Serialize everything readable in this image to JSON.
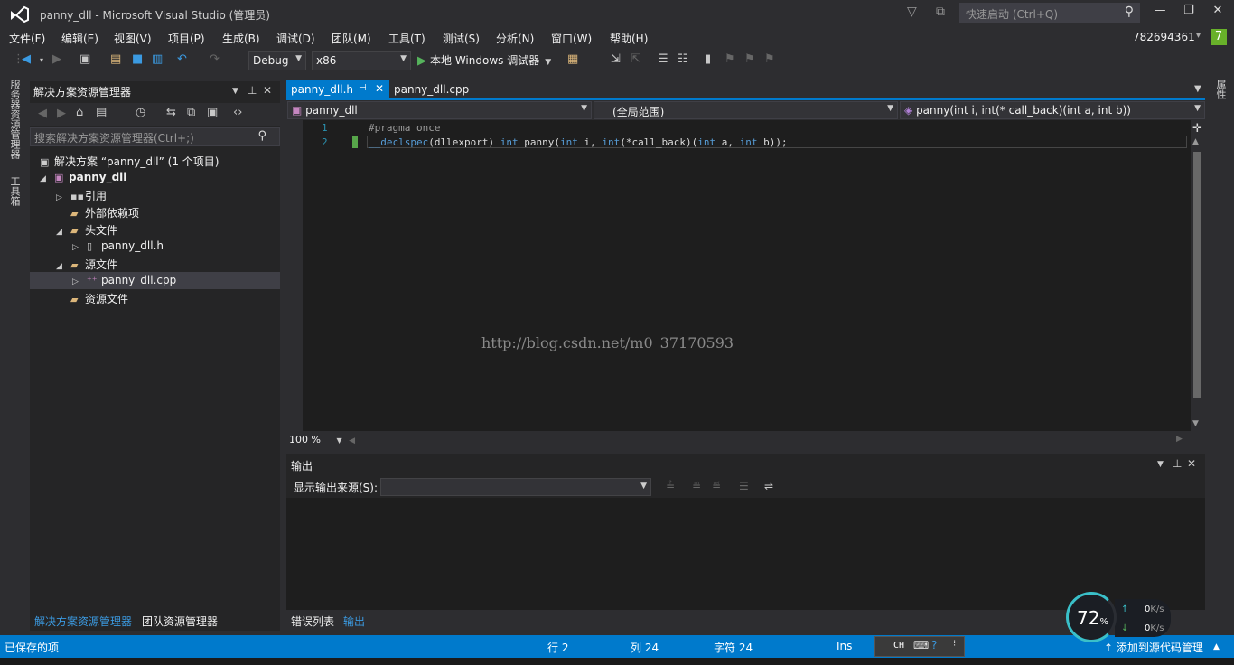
{
  "window": {
    "title": "panny_dll - Microsoft Visual Studio (管理员)",
    "quick_launch_placeholder": "快速启动 (Ctrl+Q)",
    "user_name": "782694361",
    "notification_count": "7"
  },
  "menu": [
    "文件(F)",
    "编辑(E)",
    "视图(V)",
    "项目(P)",
    "生成(B)",
    "调试(D)",
    "团队(M)",
    "工具(T)",
    "测试(S)",
    "分析(N)",
    "窗口(W)",
    "帮助(H)"
  ],
  "toolbar": {
    "config": "Debug",
    "platform": "x86",
    "run_label": "本地 Windows 调试器"
  },
  "left_strip": {
    "tab1": "服务器资源管理器",
    "tab2": "工具箱"
  },
  "right_strip": {
    "tab1": "属性"
  },
  "solution_explorer": {
    "title": "解决方案资源管理器",
    "search_placeholder": "搜索解决方案资源管理器(Ctrl+;)",
    "tree": {
      "solution": "解决方案 “panny_dll” (1 个项目)",
      "project": "panny_dll",
      "references": "引用",
      "external": "外部依赖项",
      "headers": "头文件",
      "header_file": "panny_dll.h",
      "sources": "源文件",
      "source_file": "panny_dll.cpp",
      "resources": "资源文件"
    },
    "bottom_tabs": [
      "解决方案资源管理器",
      "团队资源管理器"
    ]
  },
  "editor": {
    "tabs": [
      "panny_dll.h",
      "panny_dll.cpp"
    ],
    "nav": {
      "project": "panny_dll",
      "scope": "(全局范围)",
      "member": "panny(int i, int(* call_back)(int a, int b))"
    },
    "line_numbers": [
      "1",
      "2"
    ],
    "code": {
      "line1": "#pragma once",
      "line2_parts": [
        "__declspec",
        "(dllexport) ",
        "int",
        " panny(",
        "int",
        " i, ",
        "int",
        "(*call_back)(",
        "int",
        " a, ",
        "int",
        " b));"
      ]
    },
    "watermark": "http://blog.csdn.net/m0_37170593",
    "zoom": "100 %"
  },
  "output": {
    "title": "输出",
    "source_label": "显示输出来源(S):",
    "source_value": "",
    "bottom_tabs": [
      "错误列表",
      "输出"
    ]
  },
  "status": {
    "message": "已保存的项",
    "line": "行 2",
    "col": "列 24",
    "char": "字符 24",
    "mode": "Ins",
    "ime": "CH",
    "publish": "添加到源代码管理"
  },
  "net_monitor": {
    "percent": "72",
    "unit": "%",
    "up": "0",
    "down": "0",
    "rate_unit": "K/s"
  },
  "colors": {
    "accent": "#007acc",
    "background": "#2d2d30",
    "editor_bg": "#1e1e1e",
    "keyword": "#569cd6"
  }
}
